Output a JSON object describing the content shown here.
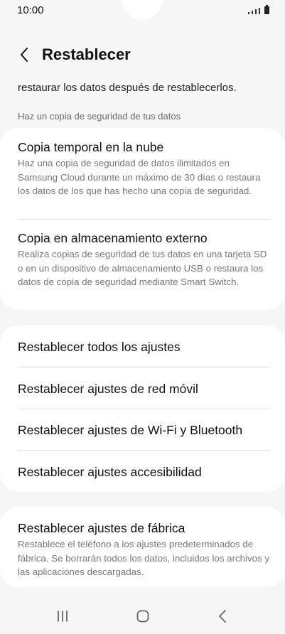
{
  "status_bar": {
    "time": "10:00"
  },
  "header": {
    "back_icon": "chevron-left-icon",
    "title": "Restablecer"
  },
  "intro_text": "restaurar los datos después de restablecerlos.",
  "backup_section": {
    "header": "Haz un copia de seguridad de tus datos",
    "items": [
      {
        "title": "Copia temporal en la nube",
        "description": "Haz una copia de seguridad de datos ilimitados en Samsung Cloud durante un máximo de 30 días o restaura los datos de los que has hecho una copia de seguridad."
      },
      {
        "title": "Copia en almacenamiento externo",
        "description": "Realiza copias de seguridad de tus datos en una tarjeta SD o en un dispositivo de almacenamiento USB o restaura los datos de copia de seguridad mediante Smart Switch."
      }
    ]
  },
  "reset_options": [
    "Restablecer todos los ajustes",
    "Restablecer ajustes de red móvil",
    "Restablecer ajustes de Wi-Fi y Bluetooth",
    "Restablecer ajustes accesibilidad"
  ],
  "factory_reset": {
    "title": "Restablecer ajustes de fábrica",
    "description": "Restablece el teléfono a los ajustes predeterminados de fábrica. Se borrarán todos los datos, incluidos los archivos y las aplicaciones descargadas."
  },
  "nav_bar": {
    "recents_icon": "recents-icon",
    "home_icon": "home-icon",
    "back_icon": "back-icon"
  },
  "colors": {
    "background": "#f6f6f6",
    "card": "#ffffff",
    "secondary_text": "#777777",
    "section_header": "#6a6a6a"
  }
}
